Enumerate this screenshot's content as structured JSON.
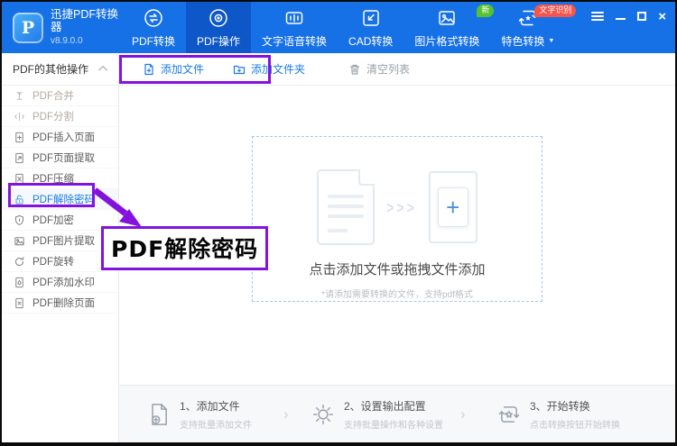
{
  "window": {
    "title": "迅捷PDF转换器",
    "version": "v8.9.0.0"
  },
  "header": {
    "background": "#1771e6",
    "selected_tab_background": "#0d57c9",
    "tabs": [
      {
        "label": "PDF转换",
        "selected": false
      },
      {
        "label": "PDF操作",
        "selected": true
      },
      {
        "label": "文字语音转换",
        "selected": false
      },
      {
        "label": "CAD转换",
        "selected": false
      },
      {
        "label": "图片格式转换",
        "selected": false,
        "badge": "新",
        "badge_color": "#57c22d"
      },
      {
        "label": "特色转换",
        "selected": false,
        "badge": "文字识别",
        "badge_color": "#f5554d",
        "has_dropdown": true
      }
    ]
  },
  "sidebar": {
    "header": "PDF的其他操作",
    "items": [
      {
        "label": "PDF合并",
        "icon": "merge-icon"
      },
      {
        "label": "PDF分割",
        "icon": "split-icon"
      },
      {
        "label": "PDF插入页面",
        "icon": "page-insert-icon"
      },
      {
        "label": "PDF页面提取",
        "icon": "page-extract-icon"
      },
      {
        "label": "PDF压缩",
        "icon": "compress-icon"
      },
      {
        "label": "PDF解除密码",
        "icon": "unlock-icon",
        "active": true
      },
      {
        "label": "PDF加密",
        "icon": "shield-icon"
      },
      {
        "label": "PDF图片提取",
        "icon": "image-icon"
      },
      {
        "label": "PDF旋转",
        "icon": "rotate-icon"
      },
      {
        "label": "PDF添加水印",
        "icon": "watermark-icon"
      },
      {
        "label": "PDF删除页面",
        "icon": "page-delete-icon"
      }
    ]
  },
  "toolbar": {
    "add_file": "添加文件",
    "add_folder": "添加文件夹",
    "clear_list": "清空列表"
  },
  "dropzone": {
    "main_text": "点击添加文件或拖拽文件添加",
    "sub_text": "*请添加需要转换的文件，支持pdf格式"
  },
  "annotation": {
    "label": "PDF解除密码",
    "color": "#8312dd"
  },
  "steps": [
    {
      "title": "1、添加文件",
      "subtitle": "支持批量添加文件"
    },
    {
      "title": "2、设置输出配置",
      "subtitle": "支持批量操作和各种设置"
    },
    {
      "title": "3、开始转换",
      "subtitle": "点击转换按钮开始转换"
    }
  ],
  "icons": {
    "caret_down": "▼",
    "chevrons": ">>>",
    "plus_glyph": "+",
    "step_separator": "›"
  },
  "colors": {
    "accent_blue": "#1a7ae5",
    "annotation_purple": "#8312dd",
    "badge_green": "#57c22d",
    "badge_red": "#f5554d"
  }
}
